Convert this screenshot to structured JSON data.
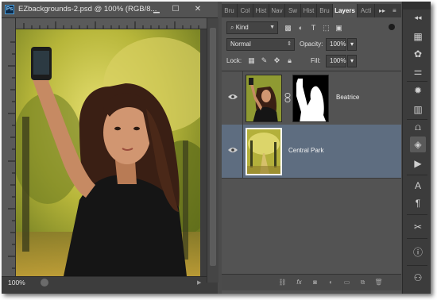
{
  "document": {
    "app_icon": "Ps",
    "title": "EZbackgrounds-2.psd @ 100% (RGB/8...",
    "controls": {
      "minimize": "▁",
      "maximize": "☐",
      "close": "✕"
    },
    "zoom": "100%"
  },
  "panel": {
    "tabs": [
      "Bru",
      "Col",
      "Hist",
      "Nav",
      "Sw",
      "Hist",
      "Bru",
      "Layers",
      "Acti"
    ],
    "active_tab": "Layers",
    "filter": {
      "label": "Kind",
      "icon": "search-icon"
    },
    "blend_mode": "Normal",
    "opacity_label": "Opacity:",
    "opacity_value": "100%",
    "lock_label": "Lock:",
    "fill_label": "Fill:",
    "fill_value": "100%",
    "layers": [
      {
        "name": "Beatrice",
        "visible": true,
        "has_mask": true,
        "selected": false
      },
      {
        "name": "Central Park",
        "visible": true,
        "has_mask": false,
        "selected": true
      }
    ],
    "footer_icons": [
      "link-layers-icon",
      "fx-icon",
      "add-mask-icon",
      "adjustment-layer-icon",
      "new-group-icon",
      "new-layer-icon",
      "delete-icon"
    ],
    "footer_fx": "fx"
  },
  "dock": {
    "icons": [
      "double-arrow-icon",
      "swatches-icon",
      "palette-icon",
      "sliders-icon",
      "adjust-icon",
      "styles-icon",
      "histogram-icon",
      "brush-icon",
      "layers-icon",
      "actions-icon",
      "character-icon",
      "paragraph-icon",
      "tools-icon",
      "info-icon",
      "clone-icon"
    ]
  },
  "colors": {
    "ui_dark": "#3c3c3c",
    "panel": "#535353",
    "selection": "#5e6d80"
  }
}
